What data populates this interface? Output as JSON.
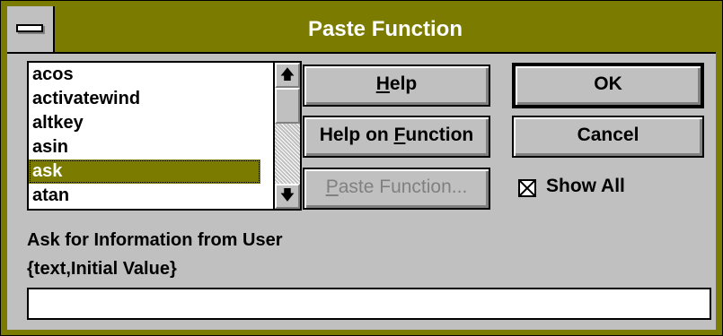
{
  "window": {
    "title": "Paste Function"
  },
  "functions": [
    "acos",
    "activatewind",
    "altkey",
    "asin",
    "ask",
    "atan"
  ],
  "selected_index": 4,
  "buttons": {
    "help": "Help",
    "ok": "OK",
    "help_on_function": "Help on Function",
    "cancel": "Cancel",
    "paste_function": "Paste Function..."
  },
  "show_all": {
    "label": "Show All",
    "checked": true
  },
  "description": "Ask for Information from User",
  "syntax": "{text,Initial Value}",
  "arguments_value": ""
}
